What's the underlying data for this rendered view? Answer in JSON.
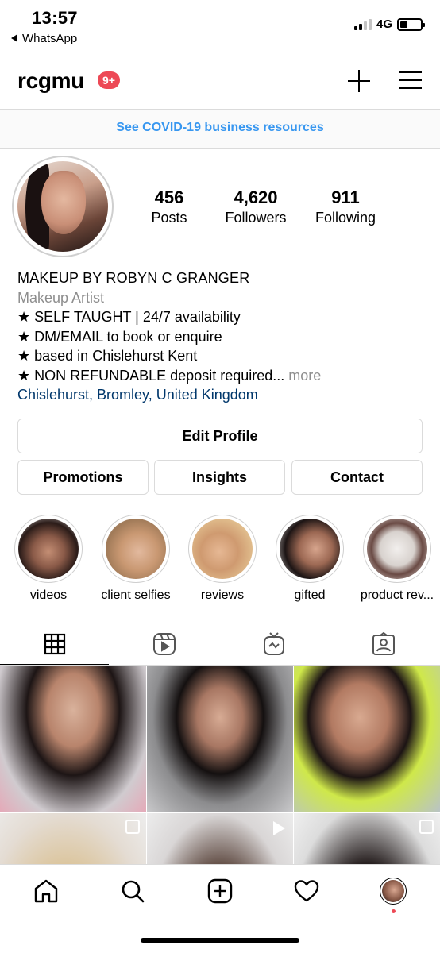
{
  "status_bar": {
    "time": "13:57",
    "back_app": "WhatsApp",
    "network": "4G"
  },
  "header": {
    "username": "rcgmu",
    "notification_badge": "9+",
    "new_post_icon": "plus-icon",
    "menu_icon": "hamburger-menu-icon"
  },
  "banner": {
    "text": "See COVID-19 business resources",
    "color": "#3897f0"
  },
  "profile": {
    "stats": [
      {
        "value": "456",
        "label": "Posts"
      },
      {
        "value": "4,620",
        "label": "Followers"
      },
      {
        "value": "911",
        "label": "Following"
      }
    ],
    "name": "MAKEUP BY ROBYN C GRANGER",
    "category": "Makeup Artist",
    "bio_lines": [
      "★ SELF TAUGHT | 24/7 availability",
      "★ DM/EMAIL to book or enquire",
      "★ based in Chislehurst Kent",
      "★ NON REFUNDABLE deposit required..."
    ],
    "more_label": "more",
    "location": "Chislehurst, Bromley, United Kingdom"
  },
  "buttons": {
    "edit_profile": "Edit Profile",
    "promotions": "Promotions",
    "insights": "Insights",
    "contact": "Contact"
  },
  "highlights": [
    {
      "label": "videos"
    },
    {
      "label": "client selfies"
    },
    {
      "label": "reviews"
    },
    {
      "label": "gifted"
    },
    {
      "label": "product rev..."
    }
  ],
  "tabs": [
    {
      "icon": "grid-icon",
      "active": true
    },
    {
      "icon": "reels-icon",
      "active": false
    },
    {
      "icon": "igtv-icon",
      "active": false
    },
    {
      "icon": "tagged-icon",
      "active": false
    }
  ],
  "bottom_nav": [
    {
      "icon": "home-icon"
    },
    {
      "icon": "search-icon"
    },
    {
      "icon": "new-post-icon"
    },
    {
      "icon": "heart-icon"
    },
    {
      "icon": "profile-avatar-icon"
    }
  ],
  "colors": {
    "badge": "#ed4956",
    "link": "#00376b",
    "muted": "#8e8e8e",
    "border": "#dbdbdb"
  }
}
